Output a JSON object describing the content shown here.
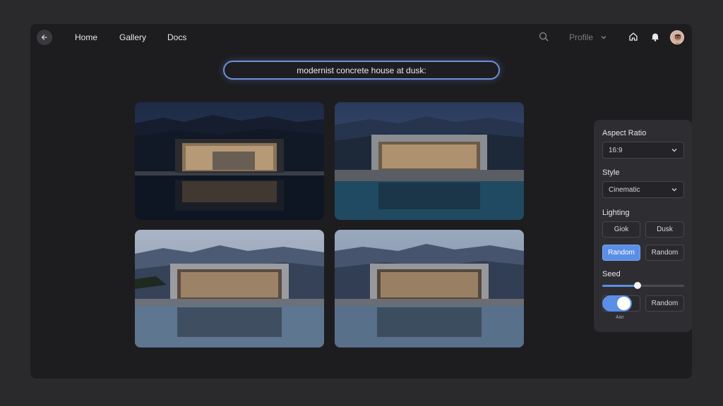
{
  "nav": {
    "home": "Home",
    "gallery": "Gallery",
    "docs": "Docs",
    "profile": "Profile"
  },
  "prompt": {
    "value": "modernist concrete house at dusk:"
  },
  "panel": {
    "aspect_ratio_label": "Aspect Ratio",
    "aspect_ratio_value": "16:9",
    "style_label": "Style",
    "style_value": "Cinematic",
    "lighting_label": "Lighting",
    "lighting_options": [
      "Giok",
      "Dusk",
      "Random",
      "Random"
    ],
    "lighting_active_index": 2,
    "seed_label": "Seed",
    "seed_slider_fraction": 0.43,
    "seed_random": "Random",
    "toggle_caption": "4an"
  },
  "colors": {
    "accent": "#5b8ee6",
    "prompt_border": "#6f90d8"
  }
}
